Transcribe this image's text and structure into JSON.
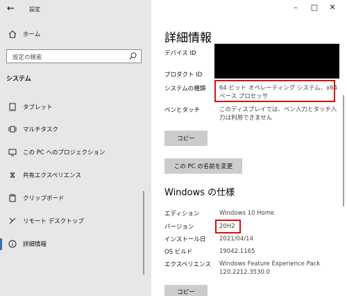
{
  "window": {
    "title": "設定"
  },
  "sidebar": {
    "home_label": "ホーム",
    "search_placeholder": "設定の検索",
    "section_title": "システム",
    "items": [
      {
        "label": "タブレット",
        "icon": "tablet-icon"
      },
      {
        "label": "マルチタスク",
        "icon": "multitask-icon"
      },
      {
        "label": "この PC へのプロジェクション",
        "icon": "projection-icon"
      },
      {
        "label": "共有エクスペリエンス",
        "icon": "shared-experience-icon"
      },
      {
        "label": "クリップボード",
        "icon": "clipboard-icon"
      },
      {
        "label": "リモート デスクトップ",
        "icon": "remote-desktop-icon"
      },
      {
        "label": "詳細情報",
        "icon": "info-icon",
        "selected": true
      }
    ]
  },
  "device_specs": {
    "heading": "詳細情報",
    "rows": [
      {
        "label": "デバイス ID",
        "value": ""
      },
      {
        "label": "プロダクト ID",
        "value": ""
      },
      {
        "label": "システムの種類",
        "value_lines": [
          "64 ビット オペレーティング システム、x64",
          "ベース プロセッサ"
        ]
      },
      {
        "label": "ペンとタッチ",
        "value_lines": [
          "このディスプレイでは、ペン入力とタッチ入",
          "力は利用できません"
        ]
      }
    ],
    "copy_button": "コピー",
    "rename_button": "この PC の名前を変更"
  },
  "windows_specs": {
    "heading": "Windows の仕様",
    "rows": [
      {
        "label": "エディション",
        "value": "Windows 10 Home"
      },
      {
        "label": "バージョン",
        "value": "20H2"
      },
      {
        "label": "インストール日",
        "value": "2021/04/14"
      },
      {
        "label": "OS ビルド",
        "value": "19042.1165"
      },
      {
        "label": "エクスペリエンス",
        "value_lines": [
          "Windows Feature Experience Pack",
          "120.2212.3530.0"
        ]
      }
    ],
    "copy_button": "コピー"
  },
  "colors": {
    "highlight": "#e10b0b",
    "accent": "#3b6fb8",
    "sidebar_bg": "#e7e7e7"
  }
}
